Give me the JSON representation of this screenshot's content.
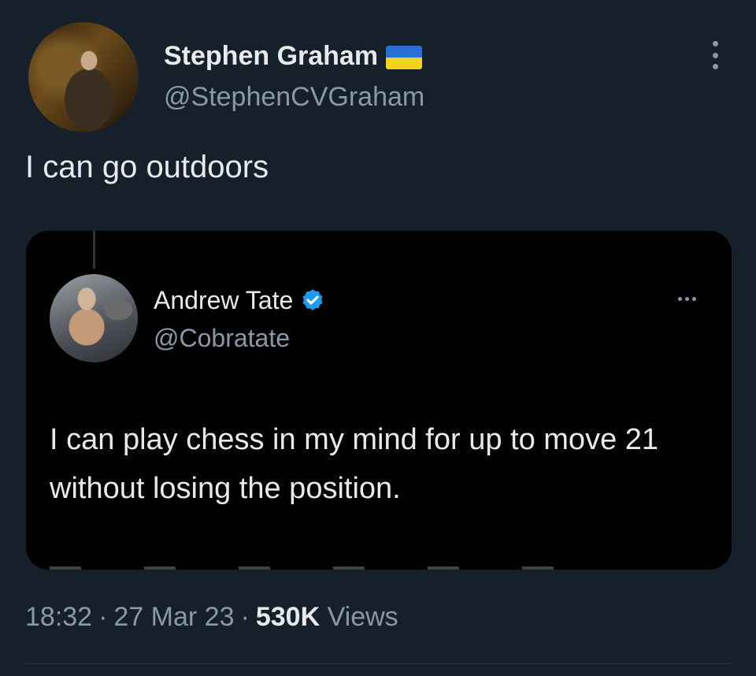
{
  "author": {
    "name": "Stephen Graham",
    "handle": "@StephenCVGraham",
    "badge_icon": "ukraine-flag-icon"
  },
  "tweet": {
    "text": "I can go outdoors"
  },
  "quoted": {
    "name": "Andrew Tate",
    "handle": "@Cobratate",
    "verified_icon": "verified-badge-icon",
    "text": "I can play chess in my mind for up to move 21 without losing the position."
  },
  "meta": {
    "time": "18:32",
    "date": "27 Mar 23",
    "views_count": "530K",
    "views_label": "Views",
    "separator": "·"
  },
  "colors": {
    "background": "#15202b",
    "quote_background": "#000000",
    "secondary_text": "#8b98a5",
    "verified_blue": "#1d9bf0"
  }
}
